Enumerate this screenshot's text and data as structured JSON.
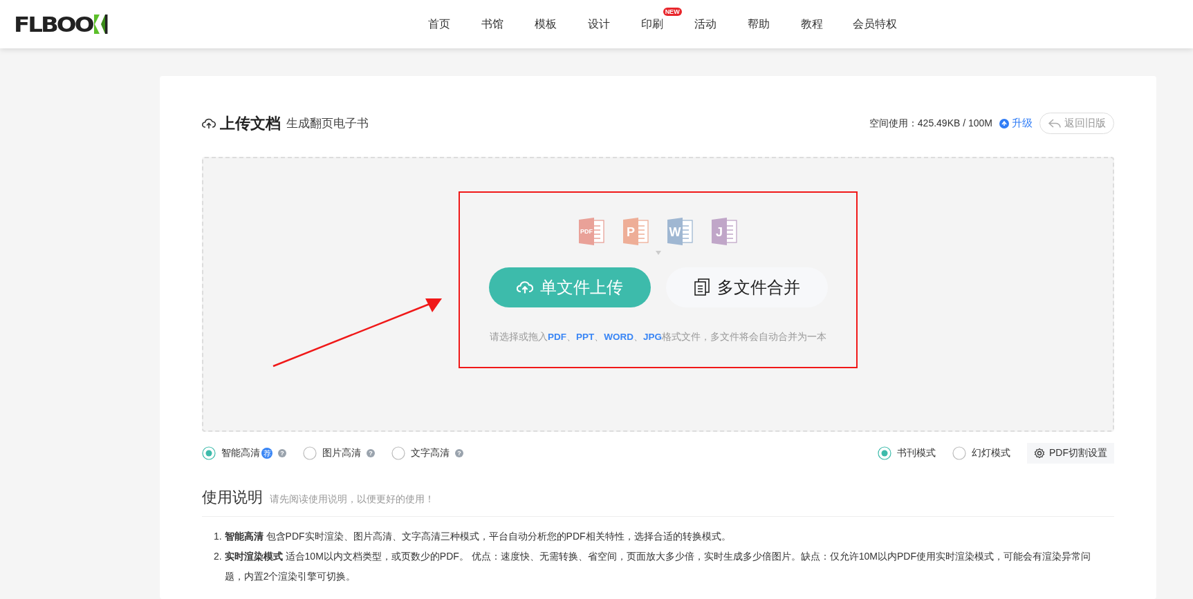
{
  "header": {
    "logo": "FLBOO",
    "nav": [
      {
        "label": "首页"
      },
      {
        "label": "书馆"
      },
      {
        "label": "模板"
      },
      {
        "label": "设计"
      },
      {
        "label": "印刷",
        "badge": "NEW"
      },
      {
        "label": "活动"
      },
      {
        "label": "帮助"
      },
      {
        "label": "教程"
      },
      {
        "label": "会员特权"
      }
    ]
  },
  "upload": {
    "title": "上传文档",
    "subtitle": "生成翻页电子书",
    "storage": "空间使用：425.49KB / 100M",
    "upgrade": "升级",
    "back_button": "返回旧版",
    "file_types": [
      {
        "label": "PDF",
        "color": "#e9a198"
      },
      {
        "label": "P",
        "color": "#eeae97"
      },
      {
        "label": "W",
        "color": "#9fb7d2"
      },
      {
        "label": "J",
        "color": "#c0a6c8"
      }
    ],
    "single_button": "单文件上传",
    "multi_button": "多文件合并",
    "hint": "请选择或拖入**PDF**、**PPT**、**WORD**、**JPG**格式文件，多文件将会自动合并为一本"
  },
  "quality_options": [
    {
      "label": "智能高清",
      "selected": true,
      "tag": "荐",
      "help": "?"
    },
    {
      "label": "图片高清",
      "selected": false,
      "help": "?"
    },
    {
      "label": "文字高清",
      "selected": false,
      "help": "?"
    }
  ],
  "mode_options": [
    {
      "label": "书刊模式",
      "selected": true
    },
    {
      "label": "幻灯模式",
      "selected": false
    }
  ],
  "split_button": "PDF切割设置",
  "guide": {
    "title": "使用说明",
    "subtitle": "请先阅读使用说明，以便更好的使用！",
    "items": [
      {
        "marker": "1.",
        "text": "**智能高清** 包含PDF实时渲染、图片高清、文字高清三种模式，平台自动分析您的PDF相关特性，选择合适的转换模式。"
      },
      {
        "marker": "2.",
        "text": "**实时渲染模式** 适合10M以内文档类型，或页数少的PDF。 优点：速度快、无需转换、省空间，页面放大多少倍，实时生成多少倍图片。缺点：仅允许10M以内PDF使用实时渲染模式，可能会有渲染异常问题，内置2个渲染引擎可切换。"
      }
    ]
  }
}
